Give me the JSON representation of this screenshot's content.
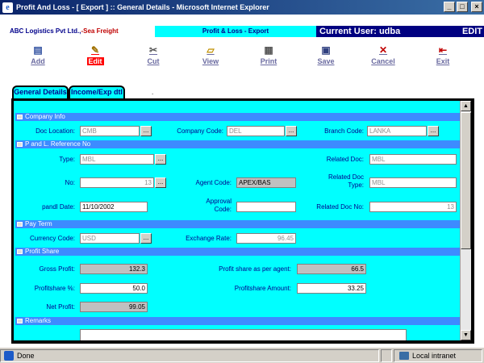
{
  "window": {
    "title": "Profit And Loss - [ Export ] :: General Details - Microsoft Internet Explorer",
    "min": "_",
    "max": "□",
    "close": "×"
  },
  "header": {
    "company": "ABC Logistics Pvt Ltd.,",
    "module": "-Sea Freight",
    "page_title": "Profit & Loss - Export",
    "current_user": "Current User: udba",
    "mode": "EDIT"
  },
  "toolbar": {
    "add": "Add",
    "edit": "Edit",
    "cut": "Cut",
    "view": "View",
    "print": "Print",
    "save": "Save",
    "cancel": "Cancel",
    "exit": "Exit"
  },
  "tabs": {
    "general": "General Details",
    "income": "Income/Exp dtl"
  },
  "sections": {
    "company_info": "Company Info",
    "pl_reference": "P and L. Reference No",
    "pay_term": "Pay Term",
    "profit_share": "Profit Share",
    "remarks": "Remarks"
  },
  "company_info": {
    "doc_location_label": "Doc Location:",
    "doc_location": "CMB",
    "company_code_label": "Company Code:",
    "company_code": "DEL",
    "branch_code_label": "Branch Code:",
    "branch_code": "LANKA"
  },
  "pl_reference": {
    "type_label": "Type:",
    "type": "MBL",
    "related_doc_label": "Related Doc:",
    "related_doc": "MBL",
    "no_label": "No:",
    "no": "13",
    "agent_code_label": "Agent Code:",
    "agent_code": "APEX/BAS",
    "related_doc_type_label_1": "Related Doc",
    "related_doc_type_label_2": "Type:",
    "related_doc_type": "MBL",
    "pandl_date_label": "pandl Date:",
    "pandl_date": "11/10/2002",
    "approval_code_label_1": "Approval",
    "approval_code_label_2": "Code:",
    "approval_code": "",
    "related_doc_no_label": "Related Doc No:",
    "related_doc_no": "13"
  },
  "pay_term": {
    "currency_code_label": "Currency Code:",
    "currency_code": "USD",
    "exchange_rate_label": "Exchange Rate:",
    "exchange_rate": "96.45"
  },
  "profit_share": {
    "gross_profit_label": "Gross Profit:",
    "gross_profit": "132.3",
    "profit_share_agent_label": "Profit share as per agent:",
    "profit_share_agent": "66.5",
    "profitshare_pct_label": "Profitshare %:",
    "profitshare_pct": "50.0",
    "profitshare_amount_label": "Profitshare Amount:",
    "profitshare_amount": "33.25",
    "net_profit_label": "Net Profit:",
    "net_profit": "99.05"
  },
  "dots": "...",
  "status": {
    "text": "Done",
    "zone": "Local intranet"
  }
}
